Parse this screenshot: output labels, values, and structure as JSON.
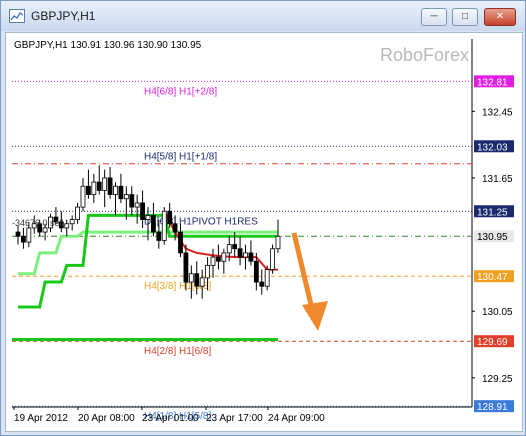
{
  "window": {
    "title": "GBPJPY,H1",
    "buttons": {
      "minimize": "─",
      "maximize": "□",
      "close": "✕"
    },
    "icon": "chart-icon"
  },
  "chart": {
    "info": "GBPJPY,H1  130.91 130.96 130.90 130.95",
    "watermark": "RoboForex",
    "left_overlay_label": "-34676.0 sell",
    "arrow_color": "#f0882c"
  },
  "chart_data": {
    "type": "candlestick",
    "symbol": "GBPJPY",
    "timeframe": "H1",
    "ohlc_current": {
      "open": 130.91,
      "high": 130.96,
      "low": 130.9,
      "close": 130.95
    },
    "y_ticks": [
      "132.45",
      "131.65",
      "130.05",
      "129.25"
    ],
    "x_ticks": [
      "19 Apr 2012",
      "20 Apr 08:00",
      "23 Apr 01:00",
      "23 Apr 17:00",
      "24 Apr 09:00"
    ],
    "ylim": [
      128.9,
      133.15
    ],
    "levels": [
      {
        "name": "H4[6/8] H1[+2/8]",
        "price": 132.81,
        "color": "#e020e0",
        "style": "dotted"
      },
      {
        "name": "H4[5/8] H1[+1/8]",
        "price": 132.03,
        "color": "#1a2a6e",
        "style": "dotted"
      },
      {
        "name": "",
        "price": 131.82,
        "color": "#e0402a",
        "style": "dashdot"
      },
      {
        "name": "D1[6/8] H1PIVOT H1RES",
        "price": 131.25,
        "color": "#1a2a6e",
        "style": "dotted"
      },
      {
        "name": "",
        "price": 130.95,
        "color": "#2a8a2a",
        "style": "dashdot"
      },
      {
        "name": "H4[3/8] H1[5/8]",
        "price": 130.47,
        "color": "#f0a020",
        "style": "dashed"
      },
      {
        "name": "H4[2/8] H1[6/8]",
        "price": 129.69,
        "color": "#e0402a",
        "style": "dashed"
      },
      {
        "name": "H4[1/8] H1[5/8]",
        "price": 128.91,
        "color": "#3a7ad8",
        "style": "dotted"
      }
    ],
    "price_tags": [
      {
        "text": "132.81",
        "price": 132.81,
        "bg": "#e020e0",
        "fg": "#ffffff"
      },
      {
        "text": "132.03",
        "price": 132.03,
        "bg": "#1a2a6e",
        "fg": "#ffffff"
      },
      {
        "text": "131.25",
        "price": 131.25,
        "bg": "#1a2a6e",
        "fg": "#ffffff"
      },
      {
        "text": "130.95",
        "price": 130.95,
        "bg": "#e8e8e8",
        "fg": "#000000"
      },
      {
        "text": "130.47",
        "price": 130.47,
        "bg": "#f0a020",
        "fg": "#ffffff"
      },
      {
        "text": "129.69",
        "price": 129.69,
        "bg": "#e0402a",
        "fg": "#ffffff"
      },
      {
        "text": "128.91",
        "price": 128.91,
        "bg": "#3a7ad8",
        "fg": "#ffffff"
      }
    ],
    "candles": [
      [
        131.0,
        131.08,
        130.85,
        130.95
      ],
      [
        130.95,
        131.05,
        130.8,
        130.88
      ],
      [
        130.88,
        131.12,
        130.82,
        131.05
      ],
      [
        131.05,
        131.2,
        130.98,
        131.1
      ],
      [
        131.1,
        131.15,
        130.95,
        131.0
      ],
      [
        131.0,
        131.1,
        130.9,
        131.05
      ],
      [
        131.05,
        131.22,
        131.0,
        131.18
      ],
      [
        131.18,
        131.3,
        131.1,
        131.12
      ],
      [
        131.12,
        131.25,
        131.0,
        131.05
      ],
      [
        131.05,
        131.15,
        130.95,
        131.1
      ],
      [
        131.1,
        131.2,
        131.02,
        131.15
      ],
      [
        131.15,
        131.35,
        131.1,
        131.3
      ],
      [
        131.3,
        131.65,
        131.25,
        131.55
      ],
      [
        131.55,
        131.75,
        131.4,
        131.45
      ],
      [
        131.45,
        131.7,
        131.35,
        131.6
      ],
      [
        131.6,
        131.8,
        131.45,
        131.5
      ],
      [
        131.5,
        131.75,
        131.3,
        131.65
      ],
      [
        131.65,
        131.78,
        131.4,
        131.45
      ],
      [
        131.45,
        131.6,
        131.2,
        131.55
      ],
      [
        131.55,
        131.7,
        131.35,
        131.4
      ],
      [
        131.4,
        131.55,
        131.15,
        131.45
      ],
      [
        131.45,
        131.55,
        131.2,
        131.3
      ],
      [
        131.3,
        131.45,
        131.1,
        131.35
      ],
      [
        131.35,
        131.5,
        131.05,
        131.15
      ],
      [
        131.15,
        131.3,
        130.9,
        131.2
      ],
      [
        131.2,
        131.35,
        130.95,
        131.0
      ],
      [
        131.0,
        131.15,
        130.8,
        130.9
      ],
      [
        130.9,
        131.3,
        130.85,
        131.25
      ],
      [
        131.25,
        131.35,
        131.05,
        131.1
      ],
      [
        131.1,
        131.2,
        130.9,
        131.0
      ],
      [
        131.0,
        131.1,
        130.7,
        130.75
      ],
      [
        130.75,
        130.85,
        130.3,
        130.4
      ],
      [
        130.4,
        130.6,
        130.2,
        130.5
      ],
      [
        130.5,
        130.65,
        130.25,
        130.35
      ],
      [
        130.35,
        130.55,
        130.2,
        130.45
      ],
      [
        130.45,
        130.7,
        130.3,
        130.6
      ],
      [
        130.6,
        130.8,
        130.45,
        130.7
      ],
      [
        130.7,
        130.85,
        130.55,
        130.65
      ],
      [
        130.65,
        130.8,
        130.5,
        130.75
      ],
      [
        130.75,
        130.95,
        130.65,
        130.85
      ],
      [
        130.85,
        131.0,
        130.7,
        130.8
      ],
      [
        130.8,
        130.95,
        130.6,
        130.7
      ],
      [
        130.7,
        130.85,
        130.55,
        130.75
      ],
      [
        130.75,
        130.9,
        130.6,
        130.65
      ],
      [
        130.65,
        130.75,
        130.3,
        130.4
      ],
      [
        130.4,
        130.55,
        130.25,
        130.35
      ],
      [
        130.35,
        130.6,
        130.3,
        130.55
      ],
      [
        130.55,
        130.85,
        130.5,
        130.8
      ],
      [
        130.8,
        131.15,
        130.75,
        130.95
      ]
    ],
    "green_line": [
      [
        0,
        130.1
      ],
      [
        4,
        130.1
      ],
      [
        5,
        130.4
      ],
      [
        8,
        130.4
      ],
      [
        9,
        130.6
      ],
      [
        12,
        130.6
      ],
      [
        13,
        131.2
      ],
      [
        27,
        131.2
      ],
      [
        28,
        130.95
      ],
      [
        47,
        130.95
      ],
      [
        48,
        130.95
      ]
    ],
    "green_line_2": [
      [
        0,
        130.5
      ],
      [
        3,
        130.5
      ],
      [
        4,
        130.75
      ],
      [
        7,
        130.75
      ],
      [
        8,
        130.95
      ],
      [
        11,
        130.95
      ],
      [
        12,
        131.0
      ],
      [
        48,
        131.0
      ]
    ],
    "red_line": [
      [
        27,
        131.25
      ],
      [
        29,
        131.0
      ],
      [
        31,
        130.8
      ],
      [
        33,
        130.75
      ],
      [
        36,
        130.72
      ],
      [
        40,
        130.7
      ],
      [
        44,
        130.7
      ],
      [
        46,
        130.55
      ],
      [
        48,
        130.55
      ]
    ]
  }
}
